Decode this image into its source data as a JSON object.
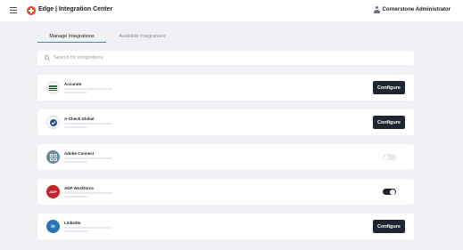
{
  "header": {
    "title": "Edge | Integration Center",
    "user_name": "Cornerstone Administrator",
    "accent_color": "#e8442c"
  },
  "tabs": [
    {
      "label": "Manage Integrations",
      "active": true
    },
    {
      "label": "Available Integrations",
      "active": false
    }
  ],
  "search": {
    "placeholder": "Search for integrations",
    "value": ""
  },
  "integrations": [
    {
      "name": "Accurate",
      "icon": "accurate-logo",
      "action": "button",
      "action_label": "Configure"
    },
    {
      "name": "A-Check Global",
      "icon": "a-check-global-logo",
      "action": "button",
      "action_label": "Configure"
    },
    {
      "name": "Adobe Connect",
      "icon": "adobe-connect-logo",
      "action": "toggle",
      "enabled": false
    },
    {
      "name": "ADP Workforce",
      "icon": "adp-logo",
      "action": "toggle",
      "enabled": true
    },
    {
      "name": "LinkedIn",
      "icon": "linkedin-logo",
      "action": "button",
      "action_label": "Configure"
    }
  ],
  "icons": {
    "accurate": "AC",
    "a_check": "✓",
    "adobe": "⌗",
    "adp": "ADP",
    "linkedin": "in"
  }
}
